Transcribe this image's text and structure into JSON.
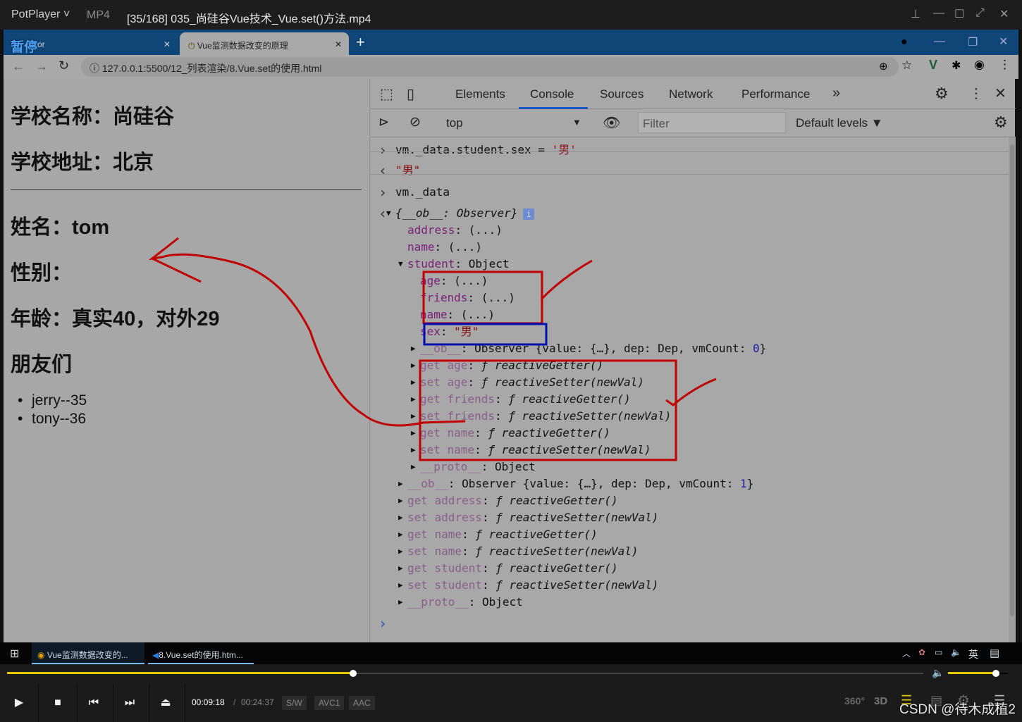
{
  "player": {
    "app": "PotPlayer",
    "format": "MP4",
    "file": "[35/168] 035_尚硅谷Vue技术_Vue.set()方法.mp4",
    "pause_osd": "暂停",
    "time_current": "00:09:18",
    "time_total": "00:24:37",
    "badges": [
      "S/W",
      "AVC1",
      "AAC"
    ],
    "progress": 0.378,
    "volume": 0.8,
    "watermark": "CSDN @待木成植2",
    "accent": "#e6c800"
  },
  "browser": {
    "tabs": [
      {
        "label": "Error"
      },
      {
        "label": "Vue监测数据改变的原理"
      }
    ],
    "url": "127.0.0.1:5500/12_列表渲染/8.Vue.set的使用.html"
  },
  "page": {
    "school_name": "学校名称：尚硅谷",
    "school_addr": "学校地址：北京",
    "name": "姓名：tom",
    "sex": "性别：",
    "age": "年龄：真实40，对外29",
    "friends_title": "朋友们",
    "friends": [
      "jerry--35",
      "tony--36"
    ]
  },
  "devtools": {
    "tabs": [
      "Elements",
      "Console",
      "Sources",
      "Network",
      "Performance"
    ],
    "active_tab": "Console",
    "context": "top",
    "filter_placeholder": "Filter",
    "levels": "Default levels ▼"
  },
  "console": [
    {
      "p": ">",
      "d": 0,
      "a": "",
      "seg": [
        [
          "vm._data.student.sex = ",
          ""
        ],
        [
          "'男'",
          "s"
        ]
      ]
    },
    {
      "p": "<",
      "d": 0,
      "a": "",
      "seg": [
        [
          "\"男\"",
          "s"
        ]
      ]
    },
    {
      "p": ">",
      "d": 0,
      "a": "",
      "seg": [
        [
          "vm._data",
          ""
        ]
      ]
    },
    {
      "p": "<",
      "d": 0,
      "a": "down",
      "seg": [
        [
          "{__ob__: Observer}",
          "i"
        ]
      ]
    },
    {
      "d": 1,
      "a": "",
      "seg": [
        [
          "address",
          "k"
        ],
        [
          ": (...)",
          ""
        ]
      ]
    },
    {
      "d": 1,
      "a": "",
      "seg": [
        [
          "name",
          "k"
        ],
        [
          ": (...)",
          ""
        ]
      ]
    },
    {
      "d": 1,
      "a": "down",
      "seg": [
        [
          "student",
          "k"
        ],
        [
          ": Object",
          ""
        ]
      ]
    },
    {
      "d": 2,
      "a": "",
      "seg": [
        [
          "age",
          "k"
        ],
        [
          ": (...)",
          ""
        ]
      ]
    },
    {
      "d": 2,
      "a": "",
      "seg": [
        [
          "friends",
          "k"
        ],
        [
          ": (...)",
          ""
        ]
      ]
    },
    {
      "d": 2,
      "a": "",
      "seg": [
        [
          "name",
          "k"
        ],
        [
          ": (...)",
          ""
        ]
      ]
    },
    {
      "d": 2,
      "a": "",
      "seg": [
        [
          "sex",
          "k"
        ],
        [
          ": ",
          ""
        ],
        [
          "\"男\"",
          "s"
        ]
      ]
    },
    {
      "d": 2,
      "a": "right",
      "seg": [
        [
          "__ob__",
          "dk"
        ],
        [
          ": Observer {value: {…}, dep: Dep, vmCount: ",
          ""
        ],
        [
          "0",
          "n"
        ],
        [
          "}",
          ""
        ]
      ]
    },
    {
      "d": 2,
      "a": "right",
      "seg": [
        [
          "get age",
          "dk"
        ],
        [
          ": ",
          ""
        ],
        [
          "ƒ reactiveGetter()",
          "i"
        ]
      ]
    },
    {
      "d": 2,
      "a": "right",
      "seg": [
        [
          "set age",
          "dk"
        ],
        [
          ": ",
          ""
        ],
        [
          "ƒ reactiveSetter(newVal)",
          "i"
        ]
      ]
    },
    {
      "d": 2,
      "a": "right",
      "seg": [
        [
          "get friends",
          "dk"
        ],
        [
          ": ",
          ""
        ],
        [
          "ƒ reactiveGetter()",
          "i"
        ]
      ]
    },
    {
      "d": 2,
      "a": "right",
      "seg": [
        [
          "set friends",
          "dk"
        ],
        [
          ": ",
          ""
        ],
        [
          "ƒ reactiveSetter(newVal)",
          "i"
        ]
      ]
    },
    {
      "d": 2,
      "a": "right",
      "seg": [
        [
          "get name",
          "dk"
        ],
        [
          ": ",
          ""
        ],
        [
          "ƒ reactiveGetter()",
          "i"
        ]
      ]
    },
    {
      "d": 2,
      "a": "right",
      "seg": [
        [
          "set name",
          "dk"
        ],
        [
          ": ",
          ""
        ],
        [
          "ƒ reactiveSetter(newVal)",
          "i"
        ]
      ]
    },
    {
      "d": 2,
      "a": "right",
      "seg": [
        [
          "__proto__",
          "dk"
        ],
        [
          ": Object",
          ""
        ]
      ]
    },
    {
      "d": 1,
      "a": "right",
      "seg": [
        [
          "__ob__",
          "dk"
        ],
        [
          ": Observer {value: {…}, dep: Dep, vmCount: ",
          ""
        ],
        [
          "1",
          "n"
        ],
        [
          "}",
          ""
        ]
      ]
    },
    {
      "d": 1,
      "a": "right",
      "seg": [
        [
          "get address",
          "dk"
        ],
        [
          ": ",
          ""
        ],
        [
          "ƒ reactiveGetter()",
          "i"
        ]
      ]
    },
    {
      "d": 1,
      "a": "right",
      "seg": [
        [
          "set address",
          "dk"
        ],
        [
          ": ",
          ""
        ],
        [
          "ƒ reactiveSetter(newVal)",
          "i"
        ]
      ]
    },
    {
      "d": 1,
      "a": "right",
      "seg": [
        [
          "get name",
          "dk"
        ],
        [
          ": ",
          ""
        ],
        [
          "ƒ reactiveGetter()",
          "i"
        ]
      ]
    },
    {
      "d": 1,
      "a": "right",
      "seg": [
        [
          "set name",
          "dk"
        ],
        [
          ": ",
          ""
        ],
        [
          "ƒ reactiveSetter(newVal)",
          "i"
        ]
      ]
    },
    {
      "d": 1,
      "a": "right",
      "seg": [
        [
          "get student",
          "dk"
        ],
        [
          ": ",
          ""
        ],
        [
          "ƒ reactiveGetter()",
          "i"
        ]
      ]
    },
    {
      "d": 1,
      "a": "right",
      "seg": [
        [
          "set student",
          "dk"
        ],
        [
          ": ",
          ""
        ],
        [
          "ƒ reactiveSetter(newVal)",
          "i"
        ]
      ]
    },
    {
      "d": 1,
      "a": "right",
      "seg": [
        [
          "__proto__",
          "dk"
        ],
        [
          ": Object",
          ""
        ]
      ]
    }
  ],
  "taskbar": {
    "items": [
      "Vue监测数据改变的...",
      "8.Vue.set的使用.htm..."
    ],
    "ime": "英"
  },
  "annotation_colors": {
    "red": "#c00000",
    "blue": "#0010b0"
  }
}
